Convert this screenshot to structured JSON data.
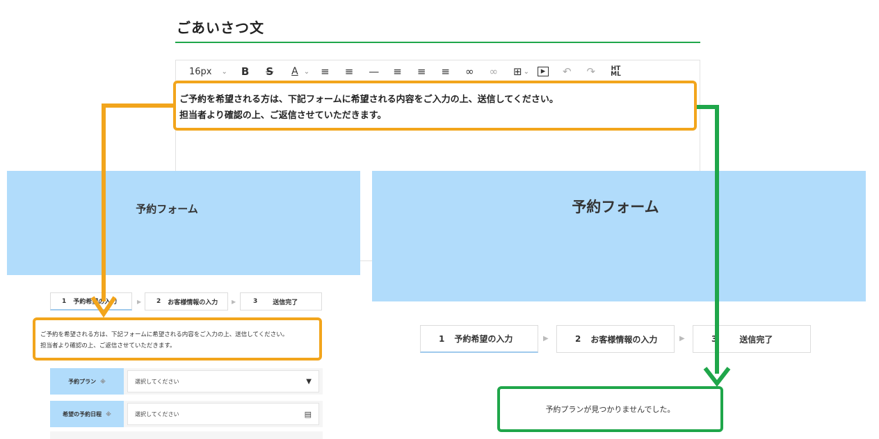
{
  "editor": {
    "title": "ごあいさつ文",
    "toolbar": {
      "font_size": "16px",
      "bold": "B",
      "strike": "S",
      "text_color": "A",
      "html": "HT\nML"
    },
    "text_line1": "ご予約を希望される方は、下記フォームに希望される内容をご入力の上、送信してください。",
    "text_line2": "担当者より確認の上、ご返信させていただきます。"
  },
  "left_preview": {
    "header_title": "予約フォーム",
    "steps": [
      {
        "num": "1",
        "label": "予約希望の入力"
      },
      {
        "num": "2",
        "label": "お客様情報の入力"
      },
      {
        "num": "3",
        "label": "送信完了"
      }
    ],
    "desc_line1": "ご予約を希望される方は、下記フォームに希望される内容をご入力の上、送信してください。",
    "desc_line2": "担当者より確認の上、ご返信させていただきます。",
    "fields": [
      {
        "label": "予約プラン",
        "required": "※",
        "value": "選択してください"
      },
      {
        "label": "希望の予約日程",
        "required": "※",
        "value": "選択してください"
      }
    ]
  },
  "right_preview": {
    "header_title": "予約フォーム",
    "steps": [
      {
        "num": "1",
        "label": "予約希望の入力"
      },
      {
        "num": "2",
        "label": "お客様情報の入力"
      },
      {
        "num": "3",
        "label": "送信完了"
      }
    ],
    "not_found": "予約プランが見つかりませんでした。"
  },
  "colors": {
    "accent_green": "#1fa64a",
    "highlight_orange": "#f2a51c",
    "header_blue": "#b1dcfb"
  }
}
